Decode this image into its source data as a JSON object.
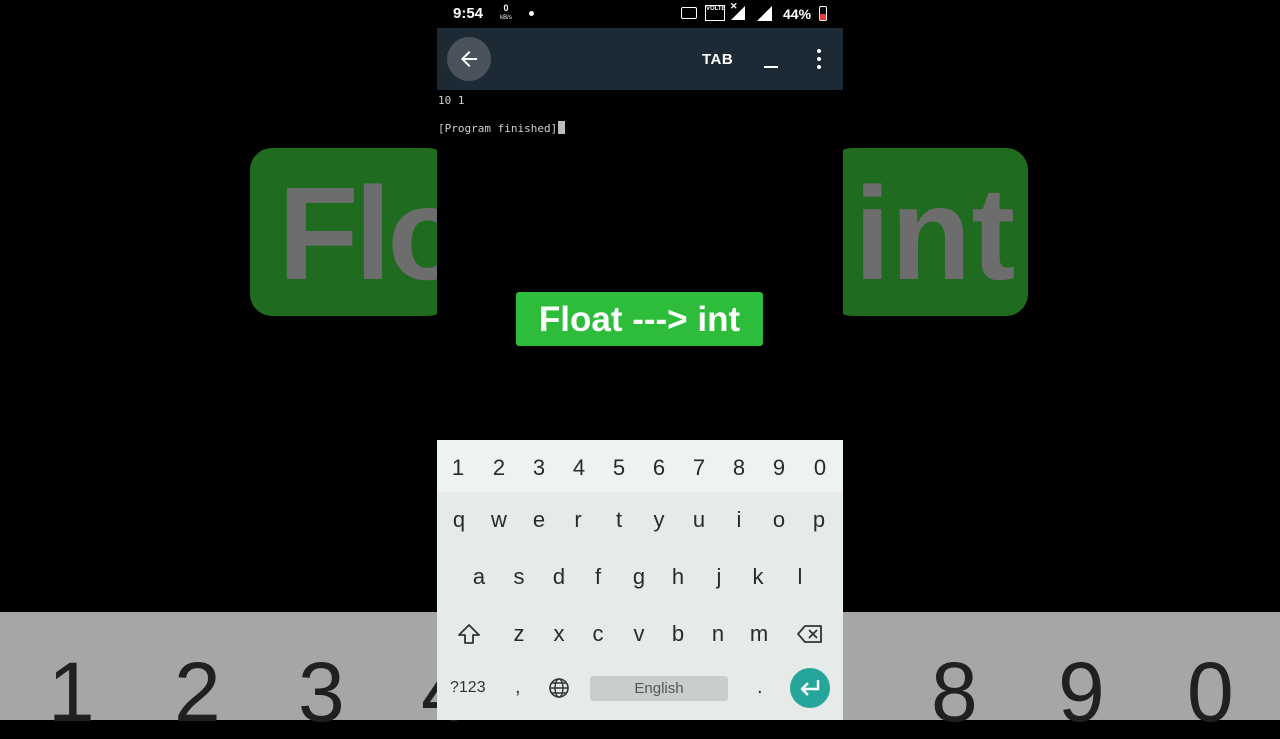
{
  "background": {
    "left_card_text": "Flo",
    "right_card_text": "int",
    "keyboard_digits": [
      "1",
      "2",
      "3",
      "4",
      "8",
      "9",
      "0"
    ]
  },
  "status_bar": {
    "time": "9:54",
    "net_speed": "0",
    "net_speed_unit": "kB/s",
    "volte": "VOLTE",
    "battery": "44%"
  },
  "app_bar": {
    "tab_label": "TAB",
    "underscore_label": "_"
  },
  "terminal": {
    "lines": [
      "10 1",
      "[Program finished]"
    ]
  },
  "caption": {
    "text": "Float ---> int"
  },
  "keyboard": {
    "number_row": [
      "1",
      "2",
      "3",
      "4",
      "5",
      "6",
      "7",
      "8",
      "9",
      "0"
    ],
    "row1": [
      "q",
      "w",
      "e",
      "r",
      "t",
      "y",
      "u",
      "i",
      "o",
      "p"
    ],
    "row2": [
      "a",
      "s",
      "d",
      "f",
      "g",
      "h",
      "j",
      "k",
      "l"
    ],
    "row3": [
      "z",
      "x",
      "c",
      "v",
      "b",
      "n",
      "m"
    ],
    "symbols_label": "?123",
    "comma": ",",
    "space_label": "English",
    "period": ".",
    "icons": [
      "shift-icon",
      "backspace-icon",
      "globe-icon",
      "enter-icon"
    ],
    "accent_color": "#26a69a"
  },
  "colors": {
    "appbar": "#1c2a35",
    "caption_bg": "#2ebd3a"
  }
}
